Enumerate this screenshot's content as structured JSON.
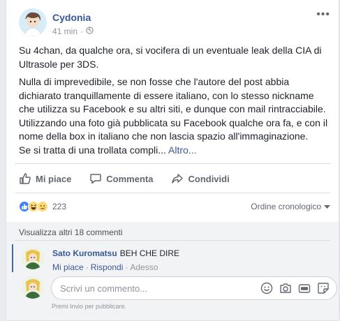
{
  "post": {
    "author": "Cydonia",
    "time": "41 min",
    "dot": "·",
    "more": "•••",
    "paragraph1": "Su 4chan, da qualche ora, si vocifera di un eventuale leak della CIA di Ultrasole per 3DS.",
    "paragraph2": "Nulla di imprevedibile, se non fosse che l'autore del post abbia dichiarato tranquillamente di essere italiano, con lo stesso nickname che utilizza su Facebook e su altri siti, e dunque con mail rintracciabile. Utilizzando una foto già pubblicata su Facebook qualche ora fa, e con il nome della box in italiano che non lascia spazio all'immaginazione.",
    "paragraph3": "Se si tratta di una trollata compli...",
    "more_link": "Altro..."
  },
  "actions": {
    "like": "Mi piace",
    "comment": "Commenta",
    "share": "Condividi"
  },
  "reactions": {
    "count": "223",
    "types": [
      "like-icon",
      "haha-icon",
      "sad-icon"
    ]
  },
  "order": {
    "label": "Ordine cronologico"
  },
  "comments": {
    "view_more": "Visualizza altri 18 commenti",
    "items": [
      {
        "author": "Sato Kuromatsu",
        "text": "BEH CHE DIRE",
        "like": "Mi piace",
        "reply": "Rispondi",
        "time": "Adesso",
        "dot": "·"
      }
    ],
    "input_placeholder": "Scrivi un commento...",
    "input_icons": [
      "emoji-icon",
      "camera-icon",
      "gif-icon",
      "sticker-icon"
    ],
    "hint": "Premi Invio per pubblicare."
  },
  "colors": {
    "link": "#365899",
    "like_blue": "#4080ff",
    "thread_bar": "#4267b2",
    "muted": "#90949c"
  }
}
